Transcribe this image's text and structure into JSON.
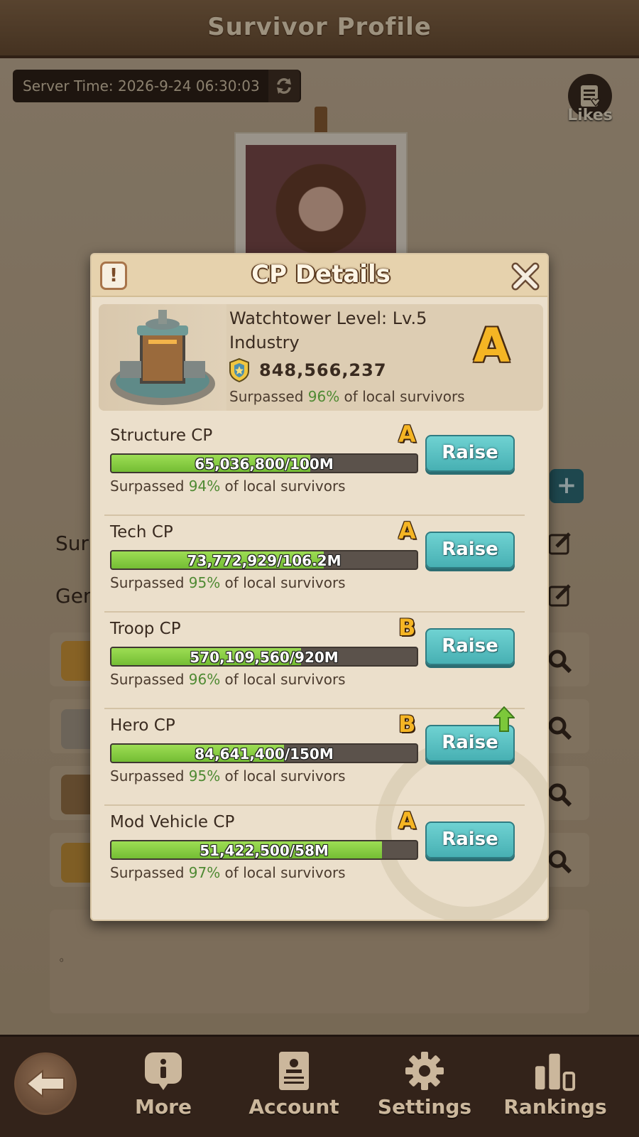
{
  "page": {
    "title": "Survivor Profile",
    "server_time": "Server Time: 2026-9-24 06:30:03",
    "likes_label": "Likes",
    "partial_text_1": "Sur",
    "partial_text_2": "Gen",
    "note_text": "◦"
  },
  "modal": {
    "title": "CP Details",
    "info_symbol": "!",
    "summary": {
      "watchtower_level": "Watchtower Level: Lv.5",
      "type": "Industry",
      "total_cp": "848,566,237",
      "surpassed_prefix": "Surpassed ",
      "surpassed_pct": "96%",
      "surpassed_suffix": " of local survivors",
      "grade": "A"
    },
    "rows": [
      {
        "name": "Structure CP",
        "grade": "A",
        "bar_text": "65,036,800/100M",
        "progress": 0.65,
        "surpassed_prefix": "Surpassed ",
        "surpassed_pct": "94%",
        "surpassed_suffix": " of local survivors",
        "button": "Raise"
      },
      {
        "name": "Tech CP",
        "grade": "A",
        "bar_text": "73,772,929/106.2M",
        "progress": 0.695,
        "surpassed_prefix": "Surpassed ",
        "surpassed_pct": "95%",
        "surpassed_suffix": " of local survivors",
        "button": "Raise"
      },
      {
        "name": "Troop CP",
        "grade": "B",
        "bar_text": "570,109,560/920M",
        "progress": 0.62,
        "surpassed_prefix": "Surpassed ",
        "surpassed_pct": "96%",
        "surpassed_suffix": " of local survivors",
        "button": "Raise"
      },
      {
        "name": "Hero CP",
        "grade": "B",
        "bar_text": "84,641,400/150M",
        "progress": 0.564,
        "surpassed_prefix": "Surpassed ",
        "surpassed_pct": "95%",
        "surpassed_suffix": " of local survivors",
        "button": "Raise",
        "upgrade_arrow": true
      },
      {
        "name": "Mod Vehicle CP",
        "grade": "A",
        "bar_text": "51,422,500/58M",
        "progress": 0.887,
        "surpassed_prefix": "Surpassed ",
        "surpassed_pct": "97%",
        "surpassed_suffix": " of local survivors",
        "button": "Raise"
      }
    ]
  },
  "bottom_nav": {
    "items": [
      {
        "label": "More",
        "icon": "info-bubble-icon"
      },
      {
        "label": "Account",
        "icon": "account-card-icon"
      },
      {
        "label": "Settings",
        "icon": "gear-icon"
      },
      {
        "label": "Rankings",
        "icon": "bar-chart-icon"
      }
    ]
  },
  "colors": {
    "accent_green": "#4f8a33",
    "grade_gold": "#f5b524",
    "raise_teal": "#47b0b3",
    "bar_green": "#74bd34"
  }
}
